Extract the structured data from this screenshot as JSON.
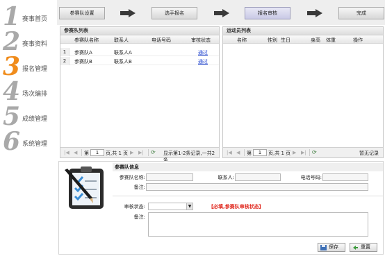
{
  "nav": {
    "items": [
      {
        "num": "1",
        "label": "赛事首页"
      },
      {
        "num": "2",
        "label": "赛事资料"
      },
      {
        "num": "3",
        "label": "报名管理"
      },
      {
        "num": "4",
        "label": "场次编排"
      },
      {
        "num": "5",
        "label": "成绩管理"
      },
      {
        "num": "6",
        "label": "系统管理"
      }
    ],
    "active_index": 2
  },
  "steps": [
    {
      "label": "参赛队设置"
    },
    {
      "label": "选手报名"
    },
    {
      "label": "报名审核"
    },
    {
      "label": "完成"
    }
  ],
  "team_list": {
    "title": "参赛队列表",
    "columns": [
      "参赛队名称",
      "联系人",
      "电话号码",
      "审核状态"
    ],
    "rows": [
      {
        "num": "1",
        "name": "参赛队A",
        "contact": "联系人A",
        "phone": "",
        "status": "通过"
      },
      {
        "num": "2",
        "name": "参赛队B",
        "contact": "联系人B",
        "phone": "",
        "status": "通过"
      }
    ],
    "pager": {
      "page_prefix": "第",
      "page_value": "1",
      "page_suffix": "页,共 1 页",
      "summary": "显示第1-2条记录,一共2条"
    }
  },
  "athlete_list": {
    "title": "运动员列表",
    "columns": [
      "名称",
      "性别",
      "生日",
      "身高",
      "体重",
      "操作"
    ],
    "pager": {
      "page_prefix": "第",
      "page_value": "1",
      "page_suffix": "页,共 1 页",
      "summary": "暂无记录"
    }
  },
  "team_info": {
    "title": "参赛队信息",
    "name_label": "参赛队名称:",
    "contact_label": "联系人:",
    "phone_label": "电话号码:",
    "note_label": "备注:",
    "review_label": "审核状态:",
    "review_value": "",
    "review_note_label": "备注:",
    "warning": "【必填,参赛队审核状态】",
    "save_label": "保存",
    "reset_label": "重置"
  },
  "colors": {
    "active_nav": "#f08c1c",
    "inactive_nav": "#a9a9a9",
    "link": "#1a3fcf",
    "warning": "#e0281e"
  }
}
